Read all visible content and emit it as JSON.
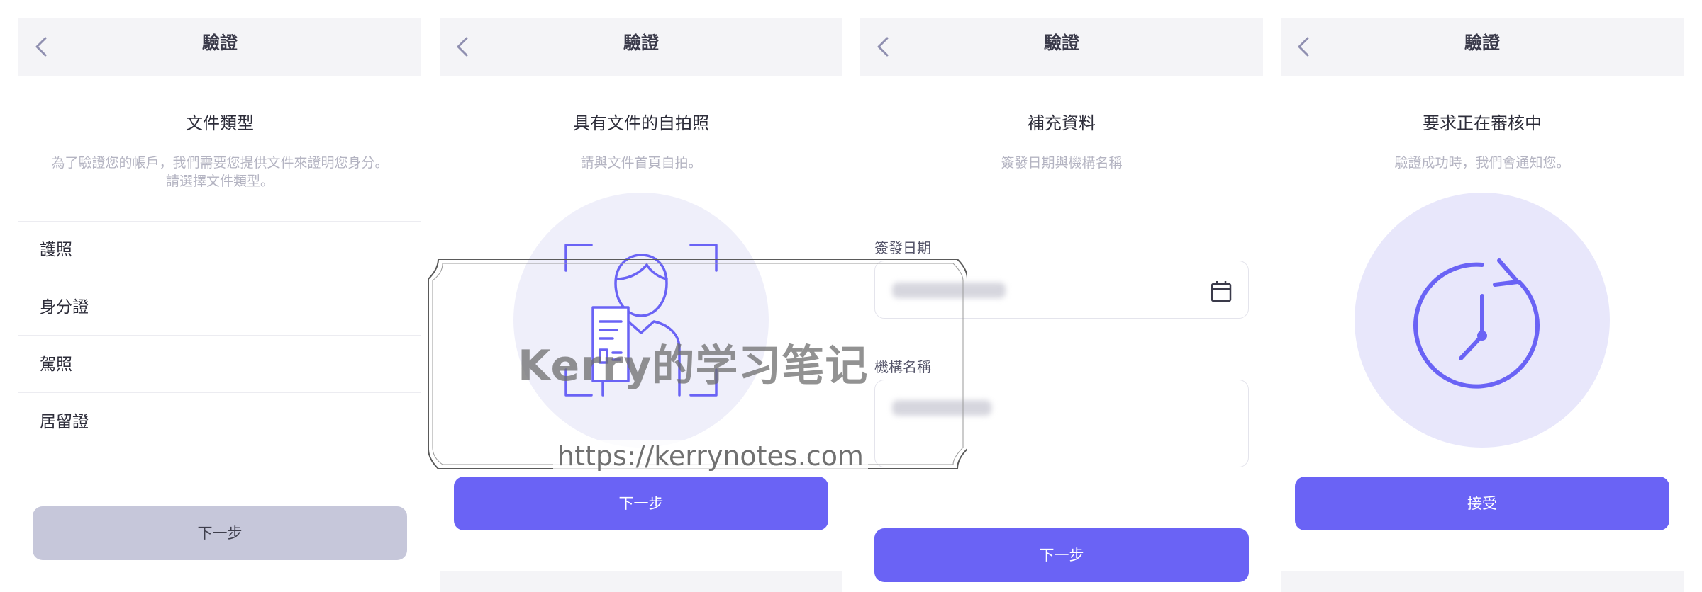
{
  "header_title": "驗證",
  "panel1": {
    "title": "文件類型",
    "subtitle_line1": "為了驗證您的帳戶，我們需要您提供文件來證明您身分。",
    "subtitle_line2": "請選擇文件類型。",
    "options": [
      "護照",
      "身分證",
      "駕照",
      "居留證"
    ],
    "next_label": "下一步"
  },
  "panel2": {
    "title": "具有文件的自拍照",
    "subtitle": "請與文件首頁自拍。",
    "illustration_icon": "selfie-with-document-icon",
    "next_label": "下一步"
  },
  "panel3": {
    "title": "補充資料",
    "subtitle": "簽發日期與機構名稱",
    "date_label": "簽發日期",
    "org_label": "機構名稱",
    "next_label": "下一步"
  },
  "panel4": {
    "title": "要求正在審核中",
    "subtitle": "驗證成功時，我們會通知您。",
    "illustration_icon": "clock-refresh-icon",
    "accept_label": "接受"
  },
  "watermark": {
    "text": "Kerry的学习笔记",
    "url": "https://kerrynotes.com"
  },
  "colors": {
    "accent": "#6a63f5",
    "disabled_button": "#c6c7da",
    "header_bg": "#f4f4f7",
    "circle_bg": "#efeffa",
    "subtitle_text": "#b4b4c2"
  }
}
